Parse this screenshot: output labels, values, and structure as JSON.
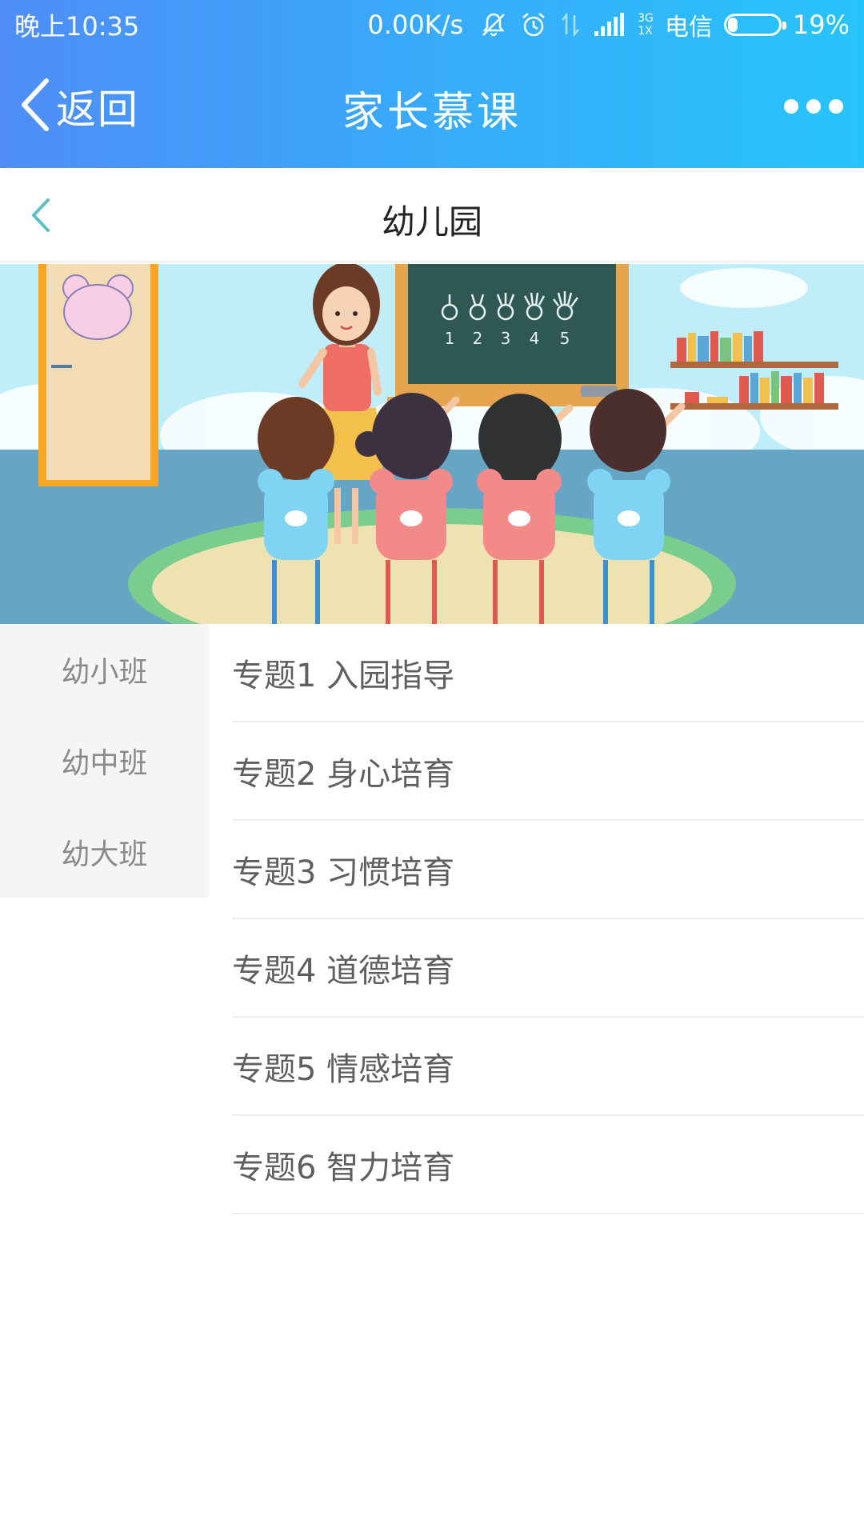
{
  "status_bar": {
    "time": "晚上10:35",
    "net_speed": "0.00K/s",
    "network_label_top": "3G",
    "network_label_bottom": "1X",
    "carrier": "电信",
    "battery_percent": "19%",
    "battery_level": 0.19,
    "icons": [
      "mute-icon",
      "alarm-icon",
      "data-arrows-icon",
      "signal-icon",
      "battery-icon"
    ]
  },
  "nav": {
    "back_label": "返回",
    "title": "家长慕课",
    "more_icon": "more-dots-icon"
  },
  "sub_header": {
    "title": "幼儿园"
  },
  "banner": {
    "blackboard_numbers": [
      "1",
      "2",
      "3",
      "4",
      "5"
    ]
  },
  "sidebar": {
    "items": [
      {
        "label": "幼小班"
      },
      {
        "label": "幼中班"
      },
      {
        "label": "幼大班"
      }
    ]
  },
  "topics": [
    {
      "label": "专题1 入园指导"
    },
    {
      "label": "专题2 身心培育"
    },
    {
      "label": "专题3 习惯培育"
    },
    {
      "label": "专题4 道德培育"
    },
    {
      "label": "专题5 情感培育"
    },
    {
      "label": "专题6 智力培育"
    }
  ],
  "colors": {
    "header_gradient_start": "#4f8df7",
    "header_gradient_end": "#27c4fb",
    "sub_back_arrow": "#5bbfc6",
    "sidebar_bg": "#f5f5f5"
  }
}
